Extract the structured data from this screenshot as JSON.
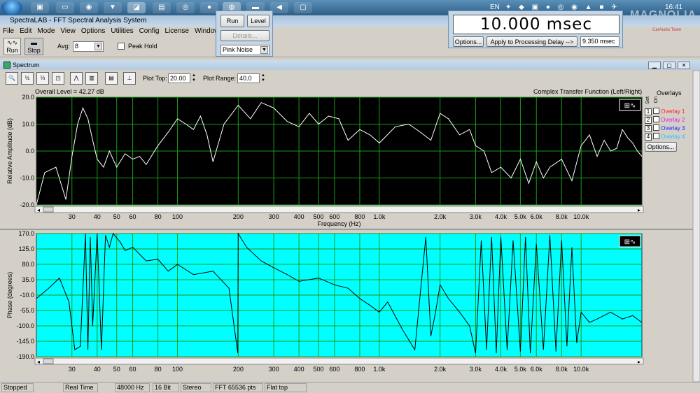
{
  "taskbar": {
    "keyboard_lang": "EN",
    "clock": "16:41",
    "watermark_brand": "MAGNOLIA",
    "watermark_team": "CarAudio Team"
  },
  "window": {
    "title": "SpectraLAB - FFT Spectral Analysis System",
    "menu": [
      "File",
      "Edit",
      "Mode",
      "View",
      "Options",
      "Utilities",
      "Config",
      "License",
      "Window"
    ]
  },
  "toolbar": {
    "run_label": "Run",
    "stop_label": "Stop",
    "avg_label": "Avg:",
    "avg_value": "8",
    "peak_hold_label": "Peak Hold"
  },
  "generator": {
    "run_label": "Run",
    "level_label": "Level",
    "details_label": "Details...",
    "signal_value": "Pink Noise"
  },
  "delay": {
    "display": "10.000 msec",
    "options_label": "Options...",
    "apply_label": "Apply to Processing Delay -->",
    "value": "9.350 msec"
  },
  "spectrum": {
    "title": "Spectrum",
    "plot_top_label": "Plot Top:",
    "plot_top_value": "20.00",
    "plot_range_label": "Plot Range:",
    "plot_range_value": "40.0",
    "overall_level": "Overall Level = 42.27 dB",
    "mode_label": "Complex Transfer Function (Left/Right)",
    "overlays_title": "Overlays",
    "set_label": "Set",
    "on_label": "On",
    "overlays": [
      {
        "num": "1",
        "label": "Overlay 1",
        "color": "#ff2020"
      },
      {
        "num": "2",
        "label": "Overlay 2",
        "color": "#e020e0"
      },
      {
        "num": "3",
        "label": "Overlay 3",
        "color": "#2020ff"
      },
      {
        "num": "4",
        "label": "Overlay 4",
        "color": "#20c0ff"
      }
    ],
    "overlays_options_label": "Options..."
  },
  "status": {
    "state": "Stopped",
    "mode": "Real Time",
    "rate": "48000 Hz",
    "bits": "16 Bit",
    "channels": "Stereo",
    "fft": "FFT 65536 pts",
    "window": "Flat top"
  },
  "chart_data": [
    {
      "type": "line",
      "ylabel": "Relative Amplitude (dB)",
      "xlabel": "Frequency (Hz)",
      "x_scale": "log",
      "xlim": [
        20,
        20000
      ],
      "ylim": [
        -20,
        20
      ],
      "y_ticks": [
        "20.0",
        "10.0",
        "0.0",
        "-10.0",
        "-20.0"
      ],
      "x_ticks": [
        "30",
        "40",
        "50",
        "60",
        "80",
        "100",
        "200",
        "300",
        "400",
        "500",
        "600",
        "800",
        "1.0k",
        "2.0k",
        "3.0k",
        "4.0k",
        "5.0k",
        "6.0k",
        "8.0k",
        "10.0k"
      ],
      "background": "#000000",
      "line_color": "#ffffff",
      "grid": true,
      "series": [
        {
          "values_x": [
            20,
            22,
            25,
            28,
            30,
            32,
            34,
            36,
            38,
            40,
            43,
            46,
            50,
            55,
            60,
            65,
            70,
            80,
            90,
            100,
            110,
            120,
            130,
            140,
            150,
            170,
            200,
            230,
            260,
            300,
            350,
            400,
            450,
            500,
            560,
            630,
            700,
            800,
            900,
            1000,
            1200,
            1400,
            1600,
            1800,
            2000,
            2200,
            2500,
            2800,
            3000,
            3300,
            3600,
            4000,
            4500,
            5000,
            5500,
            6000,
            6500,
            7000,
            8000,
            9000,
            10000,
            11000,
            12000,
            13000,
            14000,
            15000,
            16000,
            17000,
            18000,
            19000,
            20000
          ],
          "values_y": [
            -20,
            -8,
            -6,
            -18,
            -2,
            10,
            16,
            12,
            4,
            -3,
            -6,
            0,
            -6,
            -1,
            -3,
            -2,
            -5,
            2,
            7,
            12,
            10,
            8,
            13,
            6,
            -4,
            10,
            17,
            12,
            18,
            16,
            11,
            9,
            14,
            10,
            13,
            12,
            4,
            8,
            6,
            3,
            9,
            10,
            7,
            4,
            14,
            12,
            6,
            8,
            2,
            0,
            -8,
            -6,
            -10,
            -3,
            -12,
            -4,
            -10,
            -6,
            -3,
            -11,
            2,
            6,
            -2,
            4,
            0,
            1,
            8,
            5,
            3,
            0,
            -2
          ]
        }
      ]
    },
    {
      "type": "line",
      "ylabel": "Phase (degrees)",
      "x_scale": "log",
      "xlim": [
        20,
        20000
      ],
      "ylim": [
        -190,
        170
      ],
      "y_ticks": [
        "170.0",
        "125.0",
        "80.0",
        "35.0",
        "-10.0",
        "-55.0",
        "-100.0",
        "-145.0",
        "-190.0"
      ],
      "x_ticks": [
        "30",
        "40",
        "50",
        "60",
        "80",
        "100",
        "200",
        "300",
        "400",
        "500",
        "600",
        "800",
        "1.0k",
        "2.0k",
        "3.0k",
        "4.0k",
        "5.0k",
        "6.0k",
        "8.0k",
        "10.0k"
      ],
      "background": "#00ffff",
      "line_color": "#000000",
      "grid": true,
      "series": [
        {
          "values_x": [
            20,
            23,
            26,
            29,
            31,
            33,
            35,
            36,
            37,
            38,
            40,
            42,
            44,
            46,
            48,
            52,
            55,
            60,
            70,
            80,
            90,
            100,
            120,
            150,
            180,
            199,
            200,
            220,
            260,
            300,
            350,
            400,
            500,
            600,
            700,
            800,
            900,
            1000,
            1100,
            1300,
            1500,
            1700,
            1800,
            1900,
            2000,
            2200,
            2500,
            2800,
            3000,
            3200,
            3400,
            3600,
            3800,
            4000,
            4300,
            4600,
            5000,
            5300,
            5600,
            6000,
            6500,
            7000,
            7500,
            8000,
            8500,
            9000,
            9500,
            10000,
            11000,
            12000,
            14000,
            16000,
            18000,
            20000
          ],
          "values_y": [
            -20,
            10,
            40,
            -30,
            -170,
            -160,
            170,
            -170,
            160,
            -100,
            170,
            -170,
            165,
            130,
            170,
            145,
            120,
            130,
            90,
            95,
            60,
            80,
            50,
            60,
            10,
            -180,
            170,
            130,
            90,
            70,
            50,
            30,
            40,
            20,
            10,
            -20,
            -40,
            -60,
            -30,
            -110,
            -170,
            160,
            -130,
            -60,
            20,
            -20,
            -60,
            -100,
            -180,
            150,
            -170,
            160,
            -180,
            160,
            -170,
            150,
            -175,
            160,
            -180,
            140,
            -170,
            165,
            -175,
            150,
            -160,
            130,
            -150,
            -60,
            -90,
            -80,
            -60,
            -80,
            -70,
            -90
          ]
        }
      ]
    }
  ]
}
